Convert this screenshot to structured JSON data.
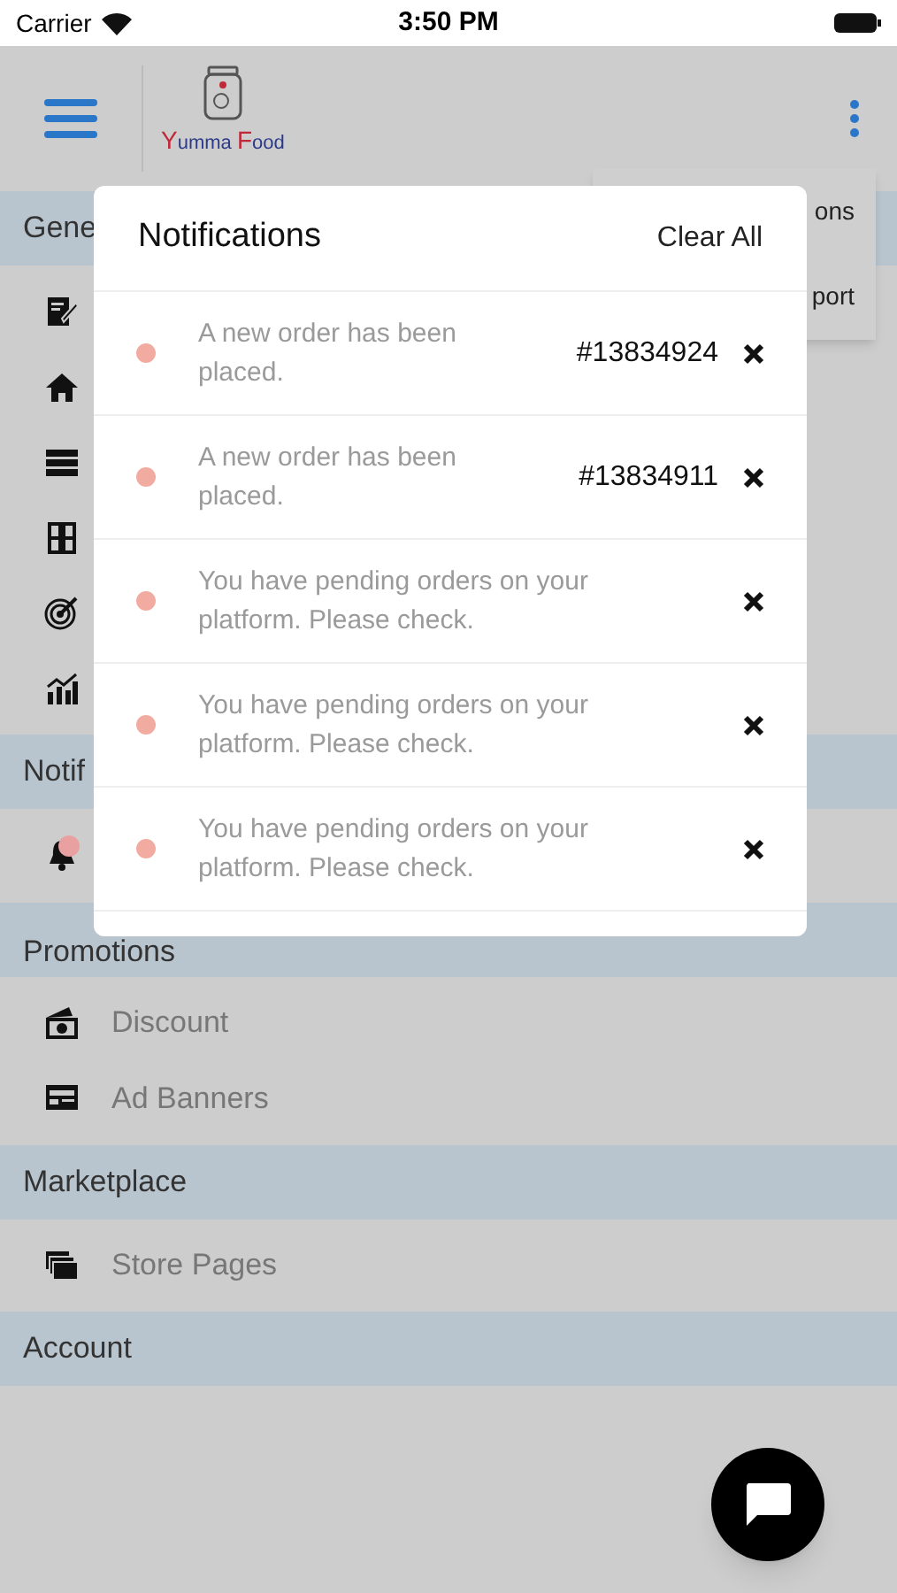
{
  "status_bar": {
    "carrier": "Carrier",
    "time": "3:50 PM"
  },
  "header": {
    "logo_text_1": "Y",
    "logo_text_2": "umma ",
    "logo_text_3": "F",
    "logo_text_4": "ood"
  },
  "dropdown": {
    "items": [
      "ons",
      "port"
    ]
  },
  "sections": [
    {
      "title": "Gene",
      "items": [
        {
          "kind": "edit"
        },
        {
          "kind": "home"
        },
        {
          "kind": "server"
        },
        {
          "kind": "book"
        },
        {
          "kind": "target"
        },
        {
          "kind": "chart"
        }
      ]
    },
    {
      "title": "Notif",
      "items": [
        {
          "kind": "bell",
          "badge": true
        }
      ]
    },
    {
      "title": "Promotions",
      "items": [
        {
          "kind": "money",
          "label": "Discount"
        },
        {
          "kind": "banner",
          "label": "Ad Banners"
        }
      ]
    },
    {
      "title": "Marketplace",
      "items": [
        {
          "kind": "layers",
          "label": "Store Pages"
        }
      ]
    },
    {
      "title": "Account"
    }
  ],
  "notifications": {
    "title": "Notifications",
    "clear_all": "Clear All",
    "items": [
      {
        "unread": true,
        "text": "A new order has been placed.",
        "order": "#13834924"
      },
      {
        "unread": true,
        "text": "A new order has been placed.",
        "order": "#13834911"
      },
      {
        "unread": true,
        "text": "You have pending orders on your platform. Please check."
      },
      {
        "unread": true,
        "text": "You have pending orders on your platform. Please check."
      },
      {
        "unread": true,
        "text": "You have pending orders on your platform. Please check."
      }
    ]
  }
}
